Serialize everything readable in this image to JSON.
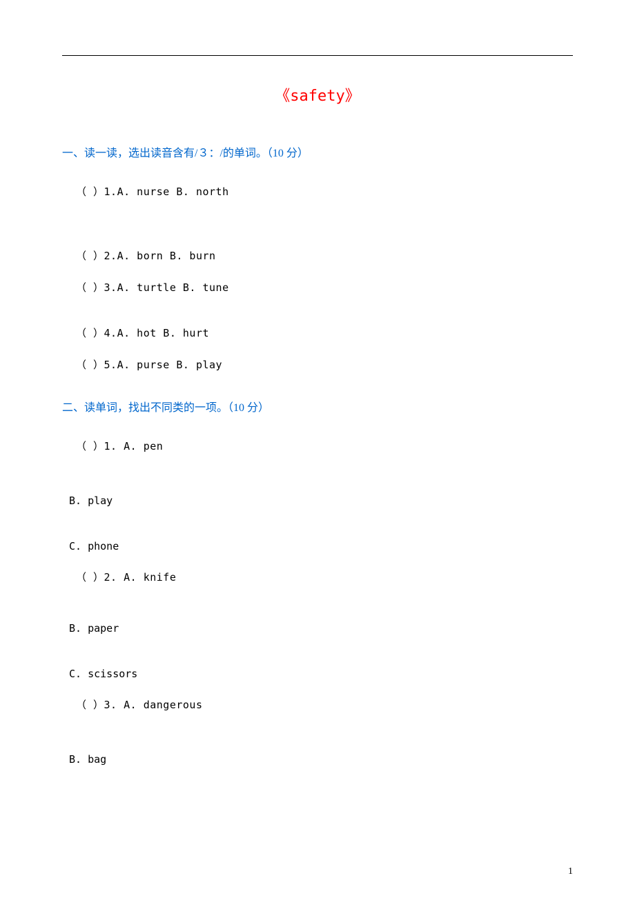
{
  "title": "《safety》",
  "section1": {
    "heading": "一、读一读，选出读音含有/３：/的单词。（10 分）",
    "questions": {
      "q1": "（ ）1.A. nurse       B. north",
      "q2": "（ ）2.A. born      B. burn",
      "q3": "（ ）3.A. turtle       B. tune",
      "q4": "（ ）4.A. hot      B. hurt",
      "q5": "（ ）5.A. purse       B. play"
    }
  },
  "section2": {
    "heading": "二、读单词，找出不同类的一项。（10 分）",
    "q1": {
      "line": "（ ）1. A. pen",
      "optB": "B. play",
      "optC": "C. phone"
    },
    "q2": {
      "line": "（ ）2. A. knife",
      "optB": "B. paper",
      "optC": "C. scissors"
    },
    "q3": {
      "line": "（ ）3. A. dangerous",
      "optB": "B. bag"
    }
  },
  "page_number": "1"
}
